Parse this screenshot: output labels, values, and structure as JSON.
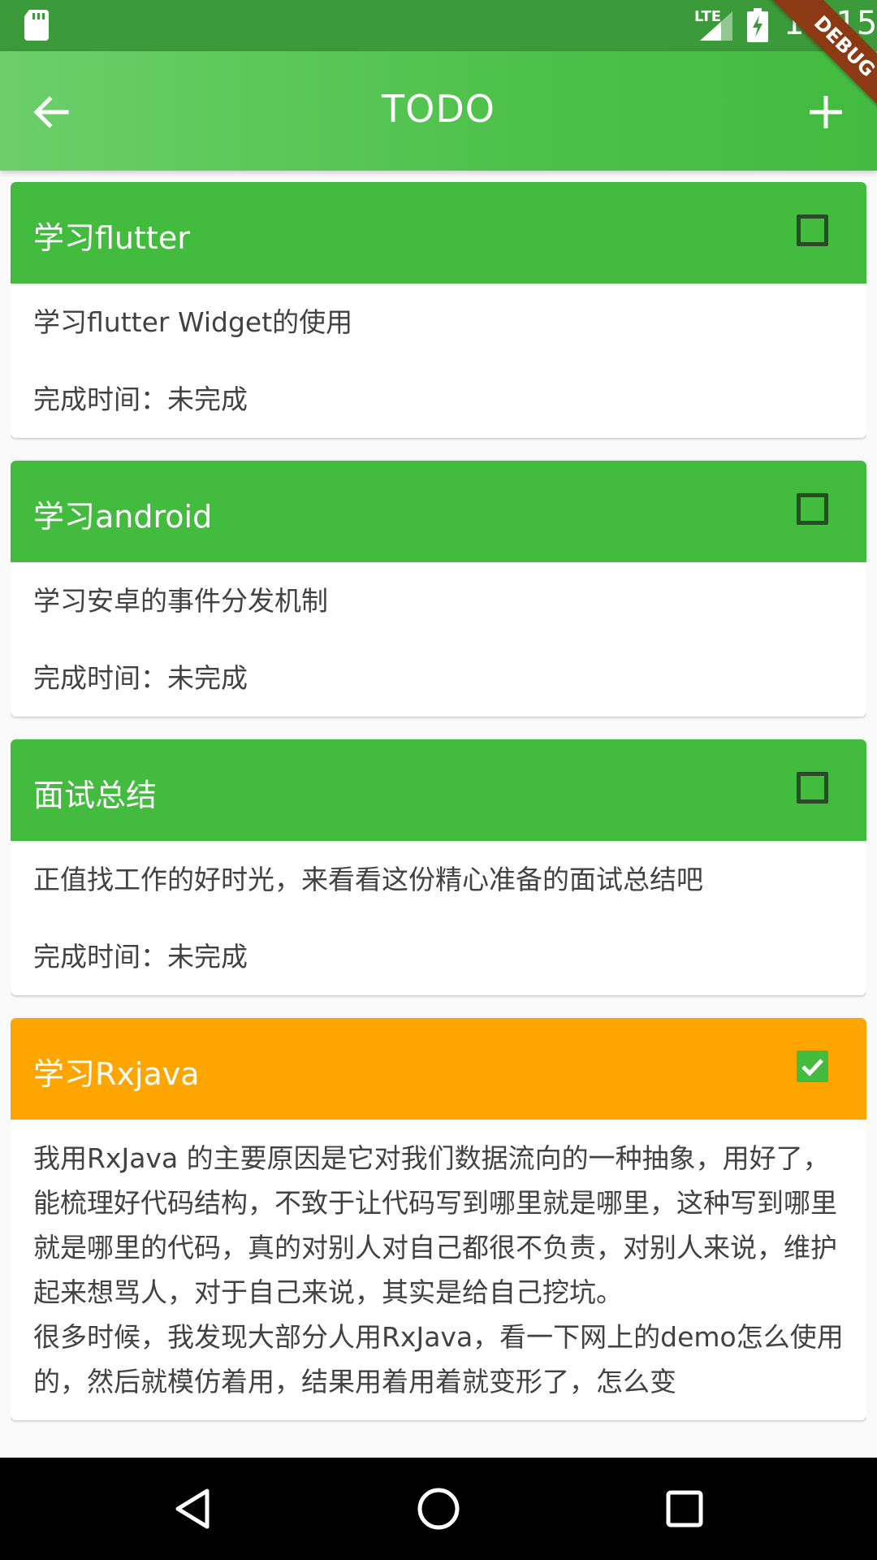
{
  "status": {
    "network": "LTE",
    "time": "12:15"
  },
  "appbar": {
    "title": "TODO"
  },
  "debug_banner": "DEBUG",
  "todos": [
    {
      "title": "学习flutter",
      "description": "学习flutter Widget的使用",
      "time_label": "完成时间：未完成",
      "done": false
    },
    {
      "title": "学习android",
      "description": "学习安卓的事件分发机制",
      "time_label": "完成时间：未完成",
      "done": false
    },
    {
      "title": "面试总结",
      "description": "正值找工作的好时光，来看看这份精心准备的面试总结吧",
      "time_label": "完成时间：未完成",
      "done": false
    },
    {
      "title": "学习Rxjava",
      "description": "我用RxJava 的主要原因是它对我们数据流向的一种抽象，用好了，能梳理好代码结构，不致于让代码写到哪里就是哪里，这种写到哪里就是哪里的代码，真的对别人对自己都很不负责，对别人来说，维护起来想骂人，对于自己来说，其实是给自己挖坑。\n很多时候，我发现大部分人用RxJava，看一下网上的demo怎么使用的，然后就模仿着用，结果用着用着就变形了，怎么变",
      "time_label": "",
      "done": true
    }
  ],
  "colors": {
    "status_bar": "#3b9a39",
    "app_bar": "#4cc149",
    "card_header_pending": "#43bb3f",
    "card_header_done": "#ffa500",
    "nav_bar": "#000000"
  },
  "icons": {
    "back": "arrow-left-icon",
    "add": "plus-icon",
    "nav_back": "triangle-back-icon",
    "nav_home": "circle-home-icon",
    "nav_recents": "square-recents-icon"
  }
}
